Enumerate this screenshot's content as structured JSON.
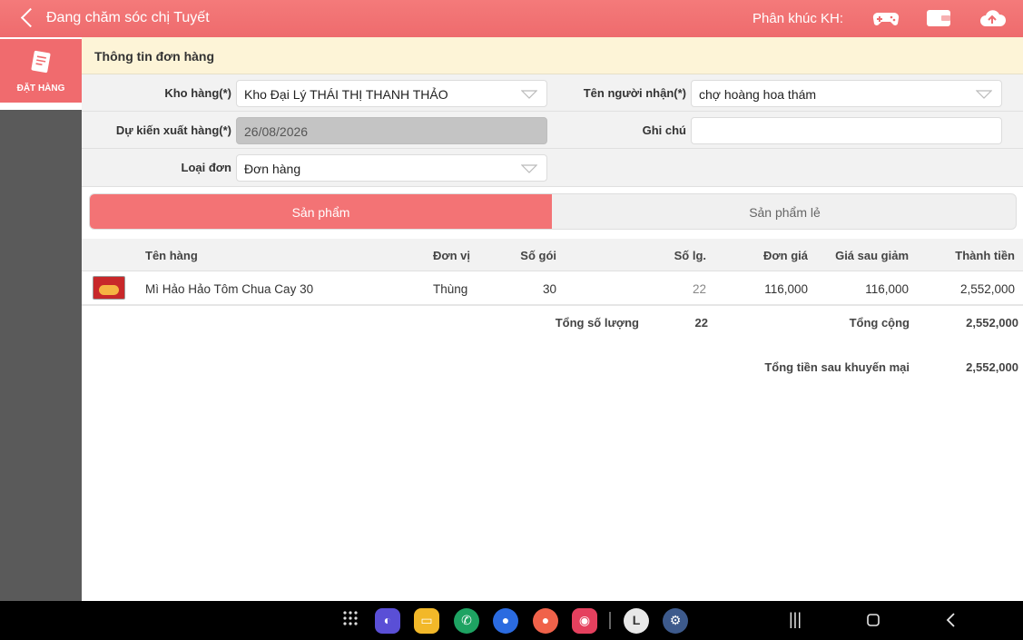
{
  "header": {
    "title": "Đang chăm sóc chị Tuyết",
    "segment_label": "Phân khúc KH:",
    "icons": [
      "back-chevron",
      "gamepad-icon",
      "wallet-icon",
      "cloud-upload-icon"
    ]
  },
  "sidebar": {
    "items": [
      {
        "label": "ĐẶT HÀNG",
        "icon": "order-icon"
      }
    ]
  },
  "order_info": {
    "section_title": "Thông tin đơn hàng",
    "warehouse_label": "Kho hàng(*)",
    "warehouse_value": "Kho Đại Lý THÁI THỊ THANH THẢO",
    "recipient_label": "Tên người nhận(*)",
    "recipient_value": "chợ hoàng hoa thám",
    "ship_date_label": "Dự kiến xuất hàng(*)",
    "ship_date_value": "26/08/2026",
    "note_label": "Ghi chú",
    "note_value": "",
    "order_type_label": "Loại đơn",
    "order_type_value": "Đơn hàng"
  },
  "tabs": [
    {
      "label": "Sản phẩm",
      "active": true
    },
    {
      "label": "Sản phẩm lẻ",
      "active": false
    }
  ],
  "table": {
    "headers": [
      "Tên hàng",
      "Đơn vị",
      "Số gói",
      "Số lg.",
      "Đơn giá",
      "Giá sau giảm",
      "Thành tiền"
    ],
    "rows": [
      {
        "name": "Mì Hảo Hảo Tôm Chua Cay 30",
        "unit": "Thùng",
        "packs": "30",
        "qty": "22",
        "price": "116,000",
        "discounted": "116,000",
        "total": "2,552,000"
      }
    ]
  },
  "totals": {
    "total_qty_label": "Tổng số lượng",
    "total_qty_value": "22",
    "grand_total_label": "Tổng cộng",
    "grand_total_value": "2,552,000",
    "after_promo_label": "Tổng tiền sau khuyến mại",
    "after_promo_value": "2,552,000"
  },
  "colors": {
    "accent": "#f06b6e",
    "header_bg": "#fdf4d7",
    "sidebar_bg": "#5a5a5a"
  },
  "system_nav": {
    "apps": [
      "apps-grid-icon",
      "browser-icon",
      "files-icon",
      "phone-icon",
      "messages-icon",
      "contacts-icon",
      "camera-icon",
      "launcher-icon",
      "settings-icon"
    ],
    "buttons": [
      "recents-button",
      "home-button",
      "back-button"
    ]
  }
}
